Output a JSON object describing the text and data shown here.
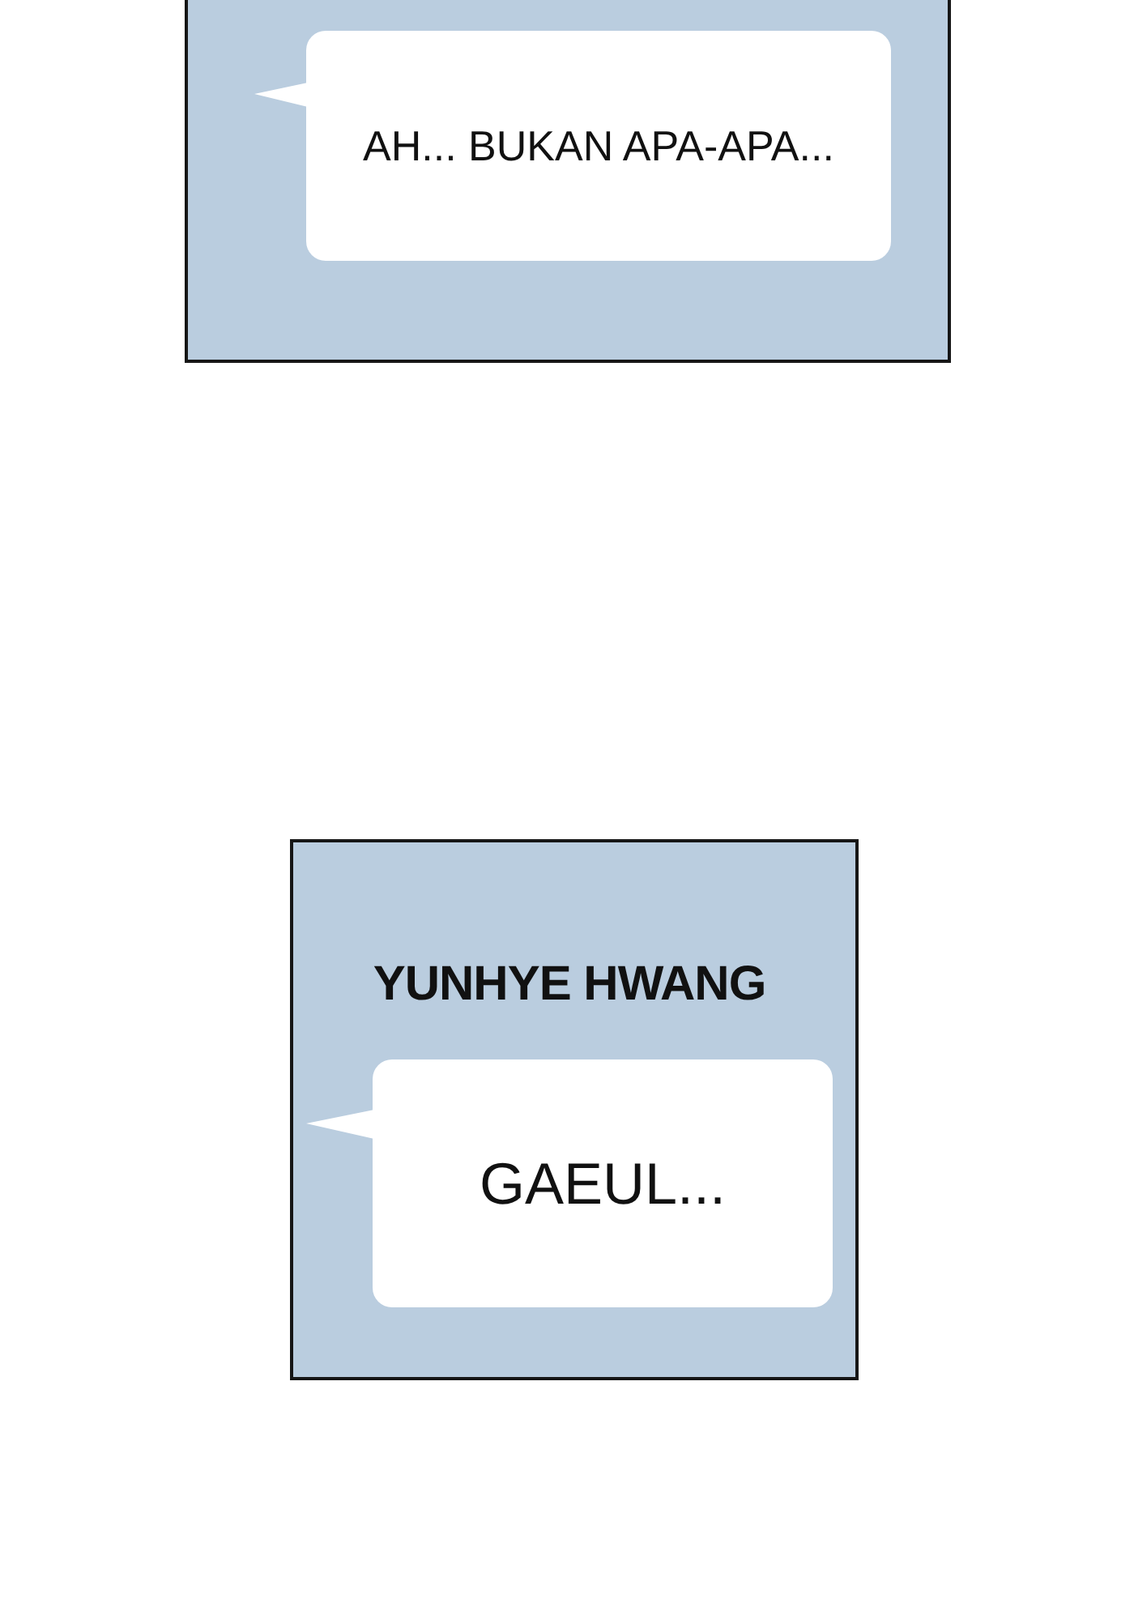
{
  "panels": [
    {
      "cut_top": true,
      "bubble": {
        "text": "AH... BUKAN APA-APA..."
      }
    },
    {
      "cut_top": false,
      "speaker": "YUNHYE HWANG",
      "bubble": {
        "text": "GAEUL..."
      }
    }
  ]
}
